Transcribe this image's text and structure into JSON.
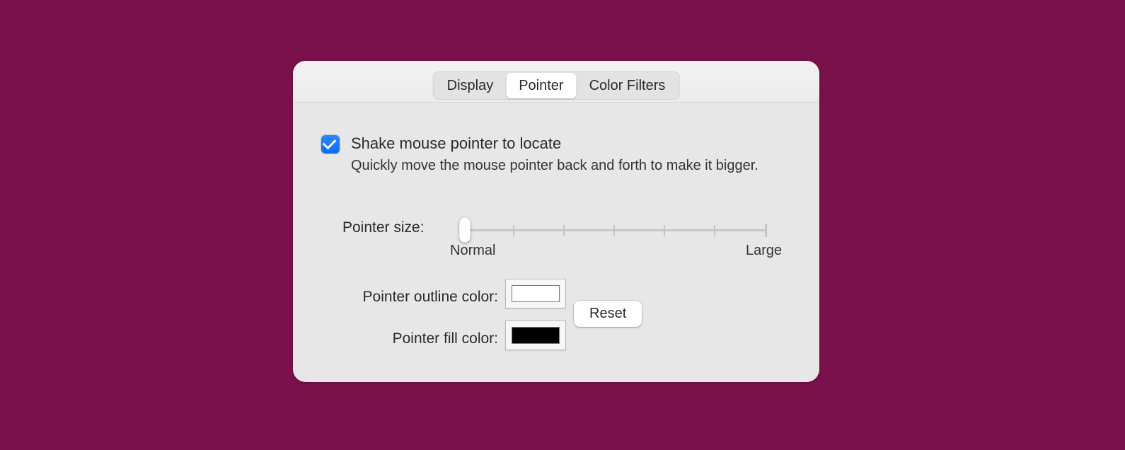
{
  "tabs": [
    "Display",
    "Pointer",
    "Color Filters"
  ],
  "active_tab_index": 1,
  "shake": {
    "checked": true,
    "label": "Shake mouse pointer to locate",
    "description": "Quickly move the mouse pointer back and forth to make it bigger."
  },
  "pointer_size": {
    "label": "Pointer size:",
    "min_label": "Normal",
    "max_label": "Large",
    "value": 0,
    "min": 0,
    "max": 6
  },
  "outline": {
    "label": "Pointer outline color:",
    "color": "#ffffff"
  },
  "fill": {
    "label": "Pointer fill color:",
    "color": "#000000"
  },
  "reset_label": "Reset"
}
